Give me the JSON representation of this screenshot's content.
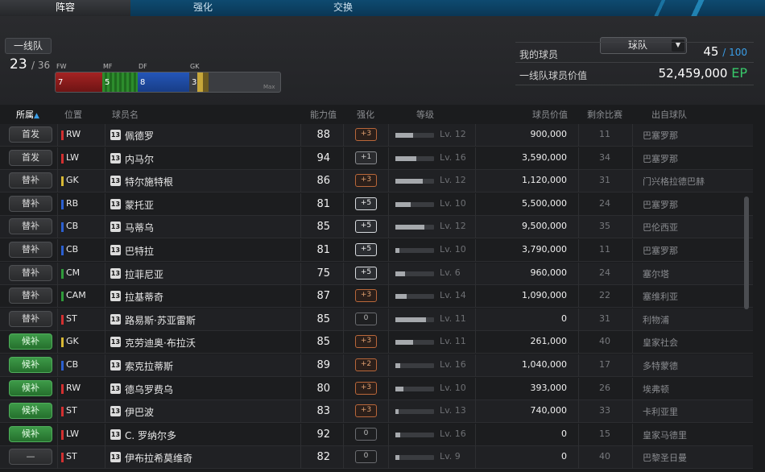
{
  "tabs": [
    {
      "label": "阵容"
    },
    {
      "label": "强化"
    },
    {
      "label": "交换"
    }
  ],
  "squad": {
    "label": "一线队",
    "count": "23",
    "max": "/ 36",
    "positions": [
      {
        "code": "FW",
        "count": "7",
        "color": "#a52323"
      },
      {
        "code": "MF",
        "count": "5",
        "color": "#2c8c2c"
      },
      {
        "code": "DF",
        "count": "8",
        "color": "#2456b8"
      },
      {
        "code": "GK",
        "count": "3",
        "color": "#c7a73a"
      }
    ],
    "max_label": "Max"
  },
  "team_select": {
    "value": "球队"
  },
  "stats": {
    "my_players_label": "我的球员",
    "my_players_value": "45",
    "my_players_max": "/ 100",
    "value_label": "一线队球员价值",
    "value_amount": "52,459,000",
    "value_unit": "EP"
  },
  "columns": {
    "role": "所属",
    "sort_icon": "▲",
    "position": "位置",
    "name": "球员名",
    "ovr": "能力值",
    "enhance": "强化",
    "level": "等级",
    "price": "球员价值",
    "games": "剩余比赛",
    "club": "出自球队"
  },
  "players": [
    {
      "role": "首发",
      "role_type": "start",
      "pos": "RW",
      "pos_color": "#d23030",
      "card": "13",
      "name": "佩德罗",
      "ovr": "88",
      "enh": "+3",
      "enh_type": "bronze",
      "lv_progress": 0.45,
      "lv": "Lv. 12",
      "price": "900,000",
      "games": "11",
      "club": "巴塞罗那"
    },
    {
      "role": "首发",
      "role_type": "start",
      "pos": "LW",
      "pos_color": "#d23030",
      "card": "13",
      "name": "内马尔",
      "ovr": "94",
      "enh": "+1",
      "enh_type": "plain",
      "lv_progress": 0.55,
      "lv": "Lv. 16",
      "price": "3,590,000",
      "games": "34",
      "club": "巴塞罗那"
    },
    {
      "role": "替补",
      "role_type": "sub",
      "pos": "GK",
      "pos_color": "#d7b834",
      "card": "13",
      "name": "特尔施特根",
      "ovr": "86",
      "enh": "+3",
      "enh_type": "bronze",
      "lv_progress": 0.7,
      "lv": "Lv. 12",
      "price": "1,120,000",
      "games": "31",
      "club": "门兴格拉德巴赫"
    },
    {
      "role": "替补",
      "role_type": "sub",
      "pos": "RB",
      "pos_color": "#2b5fd0",
      "card": "13",
      "name": "蒙托亚",
      "ovr": "81",
      "enh": "+5",
      "enh_type": "silver",
      "lv_progress": 0.4,
      "lv": "Lv. 10",
      "price": "5,500,000",
      "games": "24",
      "club": "巴塞罗那"
    },
    {
      "role": "替补",
      "role_type": "sub",
      "pos": "CB",
      "pos_color": "#2b5fd0",
      "card": "13",
      "name": "马蒂乌",
      "ovr": "85",
      "enh": "+5",
      "enh_type": "silver",
      "lv_progress": 0.75,
      "lv": "Lv. 12",
      "price": "9,500,000",
      "games": "35",
      "club": "巴伦西亚"
    },
    {
      "role": "替补",
      "role_type": "sub",
      "pos": "CB",
      "pos_color": "#2b5fd0",
      "card": "13",
      "name": "巴特拉",
      "ovr": "81",
      "enh": "+5",
      "enh_type": "silver",
      "lv_progress": 0.1,
      "lv": "Lv. 10",
      "price": "3,790,000",
      "games": "11",
      "club": "巴塞罗那"
    },
    {
      "role": "替补",
      "role_type": "sub",
      "pos": "CM",
      "pos_color": "#2f9a3a",
      "card": "13",
      "name": "拉菲尼亚",
      "ovr": "75",
      "enh": "+5",
      "enh_type": "silver",
      "lv_progress": 0.25,
      "lv": "Lv. 6",
      "price": "960,000",
      "games": "24",
      "club": "塞尔塔"
    },
    {
      "role": "替补",
      "role_type": "sub",
      "pos": "CAM",
      "pos_color": "#2f9a3a",
      "card": "13",
      "name": "拉基蒂奇",
      "ovr": "87",
      "enh": "+3",
      "enh_type": "bronze",
      "lv_progress": 0.3,
      "lv": "Lv. 14",
      "price": "1,090,000",
      "games": "22",
      "club": "塞维利亚"
    },
    {
      "role": "替补",
      "role_type": "sub",
      "pos": "ST",
      "pos_color": "#d23030",
      "card": "13",
      "name": "路易斯·苏亚雷斯",
      "ovr": "85",
      "enh": "0",
      "enh_type": "zero",
      "lv_progress": 0.8,
      "lv": "Lv. 11",
      "price": "0",
      "games": "31",
      "club": "利物浦"
    },
    {
      "role": "候补",
      "role_type": "res",
      "pos": "GK",
      "pos_color": "#d7b834",
      "card": "13",
      "name": "克劳迪奥·布拉沃",
      "ovr": "85",
      "enh": "+3",
      "enh_type": "bronze",
      "lv_progress": 0.45,
      "lv": "Lv. 11",
      "price": "261,000",
      "games": "40",
      "club": "皇家社会"
    },
    {
      "role": "候补",
      "role_type": "res",
      "pos": "CB",
      "pos_color": "#2b5fd0",
      "card": "13",
      "name": "索克拉蒂斯",
      "ovr": "89",
      "enh": "+2",
      "enh_type": "bronze",
      "lv_progress": 0.12,
      "lv": "Lv. 16",
      "price": "1,040,000",
      "games": "17",
      "club": "多特蒙德"
    },
    {
      "role": "候补",
      "role_type": "res",
      "pos": "RW",
      "pos_color": "#d23030",
      "card": "13",
      "name": "德乌罗费乌",
      "ovr": "80",
      "enh": "+3",
      "enh_type": "bronze",
      "lv_progress": 0.2,
      "lv": "Lv. 10",
      "price": "393,000",
      "games": "26",
      "club": "埃弗顿"
    },
    {
      "role": "候补",
      "role_type": "res",
      "pos": "ST",
      "pos_color": "#d23030",
      "card": "13",
      "name": "伊巴波",
      "ovr": "83",
      "enh": "+3",
      "enh_type": "bronze",
      "lv_progress": 0.08,
      "lv": "Lv. 13",
      "price": "740,000",
      "games": "33",
      "club": "卡利亚里"
    },
    {
      "role": "候补",
      "role_type": "res",
      "pos": "LW",
      "pos_color": "#d23030",
      "card": "13",
      "name": "C. 罗纳尔多",
      "ovr": "92",
      "enh": "0",
      "enh_type": "zero",
      "lv_progress": 0.12,
      "lv": "Lv. 16",
      "price": "0",
      "games": "15",
      "club": "皇家马德里"
    },
    {
      "role": "—",
      "role_type": "none",
      "pos": "ST",
      "pos_color": "#d23030",
      "card": "13",
      "name": "伊布拉希莫维奇",
      "ovr": "82",
      "enh": "0",
      "enh_type": "zero",
      "lv_progress": 0.1,
      "lv": "Lv. 9",
      "price": "0",
      "games": "40",
      "club": "巴黎圣日曼"
    }
  ]
}
